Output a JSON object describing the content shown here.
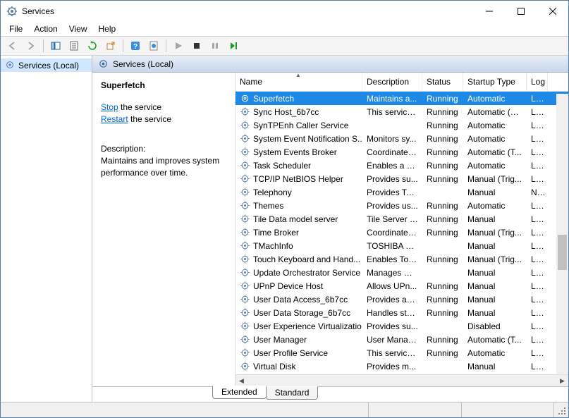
{
  "window": {
    "title": "Services"
  },
  "menu": {
    "items": [
      "File",
      "Action",
      "View",
      "Help"
    ]
  },
  "nav": {
    "label": "Services (Local)"
  },
  "pane_header": "Services (Local)",
  "detail": {
    "service_name": "Superfetch",
    "stop_label": "Stop",
    "stop_suffix": " the service",
    "restart_label": "Restart",
    "restart_suffix": " the service",
    "desc_label": "Description:",
    "desc_text": "Maintains and improves system performance over time."
  },
  "columns": {
    "name": "Name",
    "desc": "Description",
    "status": "Status",
    "startup": "Startup Type",
    "logon": "Log"
  },
  "services": [
    {
      "name": "Superfetch",
      "desc": "Maintains a...",
      "status": "Running",
      "startup": "Automatic",
      "logon": "Loc",
      "selected": true
    },
    {
      "name": "Sync Host_6b7cc",
      "desc": "This service ...",
      "status": "Running",
      "startup": "Automatic (D...",
      "logon": "Loc"
    },
    {
      "name": "SynTPEnh Caller Service",
      "desc": "",
      "status": "Running",
      "startup": "Automatic",
      "logon": "Loc"
    },
    {
      "name": "System Event Notification S...",
      "desc": "Monitors sy...",
      "status": "Running",
      "startup": "Automatic",
      "logon": "Loc"
    },
    {
      "name": "System Events Broker",
      "desc": "Coordinates...",
      "status": "Running",
      "startup": "Automatic (T...",
      "logon": "Loc"
    },
    {
      "name": "Task Scheduler",
      "desc": "Enables a us...",
      "status": "Running",
      "startup": "Automatic",
      "logon": "Loc"
    },
    {
      "name": "TCP/IP NetBIOS Helper",
      "desc": "Provides su...",
      "status": "Running",
      "startup": "Manual (Trig...",
      "logon": "Loc"
    },
    {
      "name": "Telephony",
      "desc": "Provides Tel...",
      "status": "",
      "startup": "Manual",
      "logon": "Net"
    },
    {
      "name": "Themes",
      "desc": "Provides us...",
      "status": "Running",
      "startup": "Automatic",
      "logon": "Loc"
    },
    {
      "name": "Tile Data model server",
      "desc": "Tile Server f...",
      "status": "Running",
      "startup": "Manual",
      "logon": "Loc"
    },
    {
      "name": "Time Broker",
      "desc": "Coordinates...",
      "status": "Running",
      "startup": "Manual (Trig...",
      "logon": "Loc"
    },
    {
      "name": "TMachInfo",
      "desc": "TOSHIBA M...",
      "status": "",
      "startup": "Manual",
      "logon": "Loc"
    },
    {
      "name": "Touch Keyboard and Hand...",
      "desc": "Enables Tou...",
      "status": "Running",
      "startup": "Manual (Trig...",
      "logon": "Loc"
    },
    {
      "name": "Update Orchestrator Service",
      "desc": "Manages W...",
      "status": "",
      "startup": "Manual",
      "logon": "Loc"
    },
    {
      "name": "UPnP Device Host",
      "desc": "Allows UPn...",
      "status": "Running",
      "startup": "Manual",
      "logon": "Loc"
    },
    {
      "name": "User Data Access_6b7cc",
      "desc": "Provides ap...",
      "status": "Running",
      "startup": "Manual",
      "logon": "Loc"
    },
    {
      "name": "User Data Storage_6b7cc",
      "desc": "Handles sto...",
      "status": "Running",
      "startup": "Manual",
      "logon": "Loc"
    },
    {
      "name": "User Experience Virtualizatio...",
      "desc": "Provides su...",
      "status": "",
      "startup": "Disabled",
      "logon": "Loc"
    },
    {
      "name": "User Manager",
      "desc": "User Manag...",
      "status": "Running",
      "startup": "Automatic (T...",
      "logon": "Loc"
    },
    {
      "name": "User Profile Service",
      "desc": "This service ...",
      "status": "Running",
      "startup": "Automatic",
      "logon": "Loc"
    },
    {
      "name": "Virtual Disk",
      "desc": "Provides m...",
      "status": "",
      "startup": "Manual",
      "logon": "Loc"
    }
  ],
  "tabs": {
    "extended": "Extended",
    "standard": "Standard"
  }
}
